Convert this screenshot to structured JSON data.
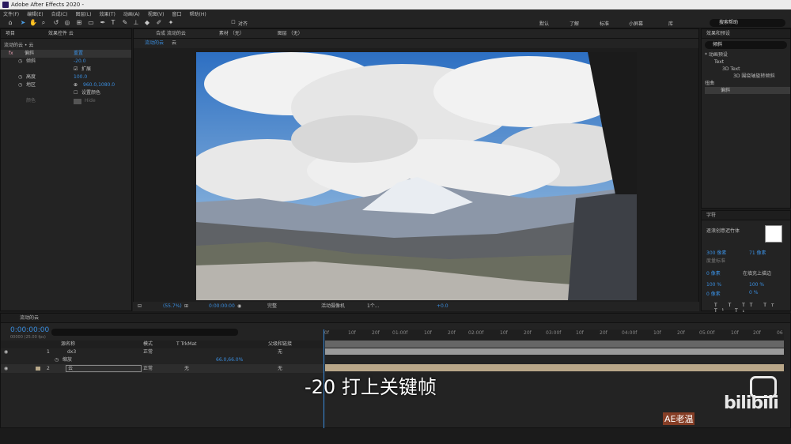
{
  "app": {
    "title": "Adobe After Effects 2020 -"
  },
  "menu": [
    "文件(F)",
    "编辑(E)",
    "合成(C)",
    "图层(L)",
    "效果(T)",
    "动画(A)",
    "视图(V)",
    "窗口",
    "帮助(H)"
  ],
  "toolbar": {
    "snap_label": "对齐",
    "workspaces": [
      "默认",
      "了解",
      "标准",
      "小屏幕",
      "库"
    ],
    "search_placeholder": "搜索帮助"
  },
  "left_panel": {
    "tab_project": "项目",
    "tab_effects": "效果控件 云",
    "breadcrumb": "流动的云 • 云",
    "effect_name": "偏斜",
    "reset_label": "重置",
    "props": [
      {
        "label": "倾斜",
        "value": "-20.0"
      },
      {
        "label": "",
        "value": "扩展"
      },
      {
        "label": "高度",
        "value": "100.0"
      },
      {
        "label": "地区",
        "value": "960.0,1080.0"
      },
      {
        "label": "",
        "value": "设置颜色"
      },
      {
        "label": "颜色",
        "value": "Hide"
      }
    ]
  },
  "comp_panel": {
    "tab_comp": "合成 流动的云",
    "tab_footage": "素材 （无）",
    "tab_layer": "图层 （无）",
    "sub_tabs": [
      "流动的云",
      "云"
    ],
    "zoom": "(55.7%)",
    "timecode": "0:00:00:00",
    "resolution": "完整",
    "camera": "活动摄像机",
    "views": "1个...",
    "exposure": "+0.0"
  },
  "right_panel": {
    "effects_title": "效果和预设",
    "search_value": "倾斜",
    "tree": [
      "* 动画预设",
      "Text",
      "3D Text",
      "3D 围绕轴旋转倾斜",
      "扭曲",
      "偏斜"
    ],
    "char_title": "字符",
    "font": "逐浪创意迟竹体",
    "size": "300 像素",
    "leading": "71 像素",
    "tracking_label": "度量标准",
    "kerning": "0 像素",
    "align_label": "在填充上描边",
    "vscale": "100 %",
    "hscale": "100 %",
    "baseline": "0 像素",
    "tsume": "0 %"
  },
  "timeline": {
    "tab": "流动的云",
    "time": "0:00:00:00",
    "frame_info": "00000 (25.00 fps)",
    "cols": {
      "source": "源名称",
      "mode": "模式",
      "trk": "T TrkMat",
      "parent": "父级和链接"
    },
    "layers": [
      {
        "num": "1",
        "name": "dx3",
        "mode": "正常",
        "parent": "无",
        "sub": "缩放",
        "sub_value": "66.0,66.0%"
      },
      {
        "num": "2",
        "name": "云",
        "mode": "正常",
        "trk": "无",
        "parent": "无"
      }
    ],
    "ruler": [
      "0f",
      "10f",
      "20f",
      "01:00f",
      "10f",
      "20f",
      "02:00f",
      "10f",
      "20f",
      "03:00f",
      "10f",
      "20f",
      "04:00f",
      "10f",
      "20f",
      "05:00f",
      "10f",
      "20f",
      "06"
    ]
  },
  "overlay": {
    "subtitle": "-20 打上关键帧",
    "watermark": "bilibili",
    "uploader": "AE老温"
  }
}
